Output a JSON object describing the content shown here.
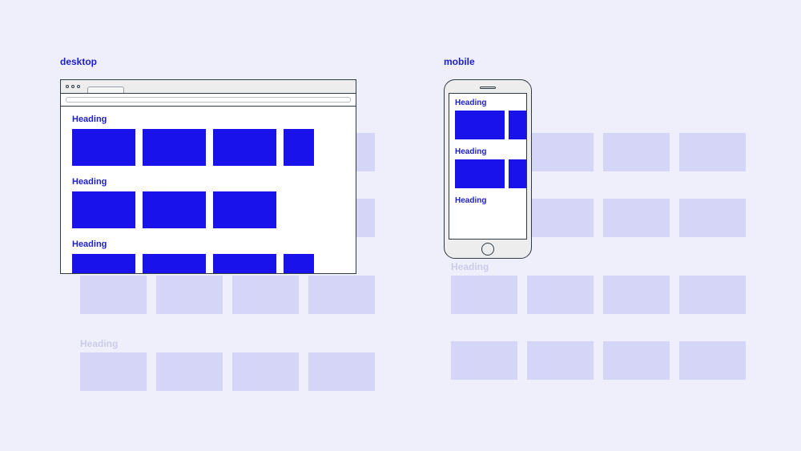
{
  "labels": {
    "desktop": "desktop",
    "mobile": "mobile"
  },
  "heading_text": "Heading",
  "bg_heading_text": "Heading",
  "colors": {
    "page_bg": "#EFEFFC",
    "accent": "#1D1DC9",
    "tile_active": "#1A12EB",
    "tile_muted": "#D4D5F7",
    "frame_stroke": "#2E3A44"
  },
  "desktop_sections": [
    {
      "heading": "Heading",
      "tiles": 4,
      "last_clipped": true
    },
    {
      "heading": "Heading",
      "tiles": 3,
      "last_clipped": false
    },
    {
      "heading": "Heading",
      "tiles": 4,
      "last_clipped": true
    }
  ],
  "mobile_sections": [
    {
      "heading": "Heading",
      "tiles": 2,
      "last_clipped": true
    },
    {
      "heading": "Heading",
      "tiles": 2,
      "last_clipped": true
    },
    {
      "heading": "Heading",
      "tiles": 0,
      "last_clipped": false
    }
  ],
  "bg_left": {
    "rows": [
      {
        "tiles": 4
      },
      {
        "tiles": 4
      },
      {
        "tiles": 4,
        "show_heading": true
      },
      {
        "tiles": 4,
        "show_heading": true
      }
    ]
  },
  "bg_right": {
    "rows": [
      {
        "tiles": 4
      },
      {
        "tiles": 4
      },
      {
        "tiles": 4,
        "show_heading": true
      },
      {
        "tiles": 4
      }
    ]
  }
}
